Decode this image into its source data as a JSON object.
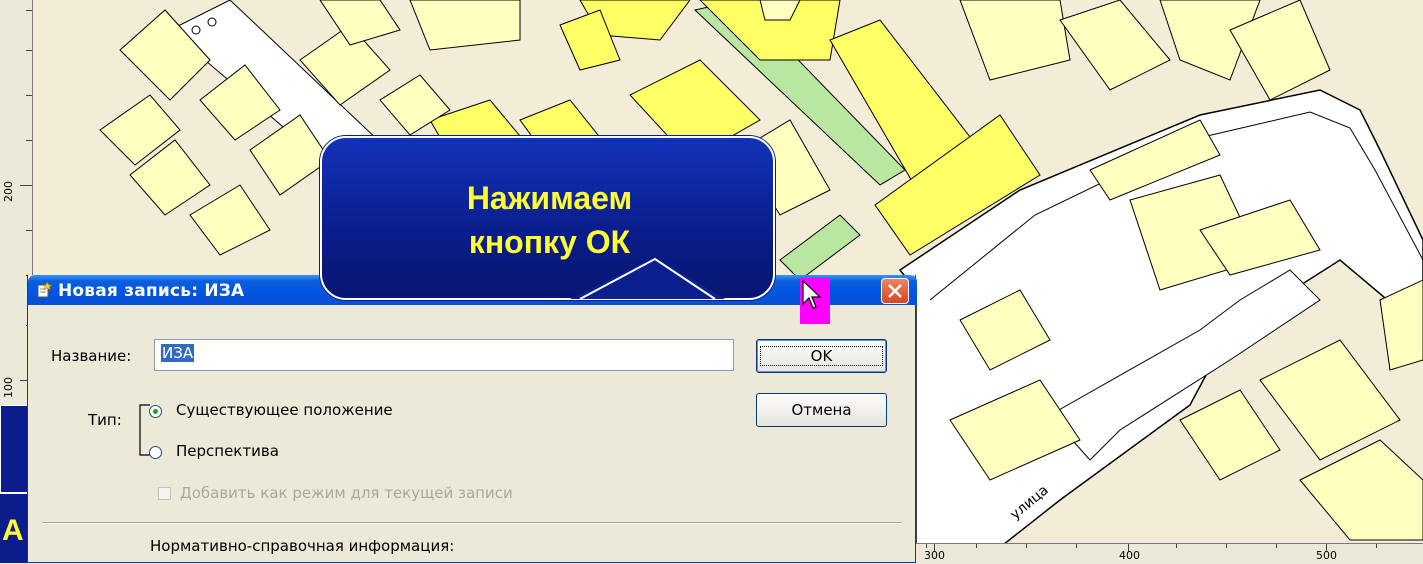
{
  "callout": {
    "text_line1": "Нажимаем",
    "text_line2": "кнопку ОК"
  },
  "left_callout": {
    "partial_letter": "А"
  },
  "dialog": {
    "title": "Новая запись: ИЗА",
    "title_icon": "new-record-icon",
    "close_icon": "close-icon",
    "name_label": "Название:",
    "name_value": "ИЗА",
    "ok_label": "OK",
    "cancel_label": "Отмена",
    "type_label": "Тип:",
    "radio_existing": "Существующее положение",
    "radio_existing_checked": true,
    "radio_perspective": "Перспектива",
    "radio_perspective_checked": false,
    "checkbox_label": "Добавить как режим для текущей записи",
    "checkbox_enabled": false,
    "reference_label": "Нормативно-справочная информация:"
  },
  "rulers": {
    "vertical_labels": [
      "200",
      "100"
    ],
    "horizontal_labels": [
      "300",
      "400",
      "500"
    ]
  },
  "map": {
    "street_label": "улица",
    "colors": {
      "background": "#f3ecd6",
      "building": "#ffffc0",
      "building_highlight": "#ffff66",
      "green": "#b9e6a0",
      "road": "#ffffff",
      "outline": "#000000"
    }
  },
  "colors": {
    "callout_bg": "#0a1d8a",
    "callout_text": "#ffff33",
    "cursor_highlight": "#ff00ff",
    "titlebar": "#0054e3"
  }
}
